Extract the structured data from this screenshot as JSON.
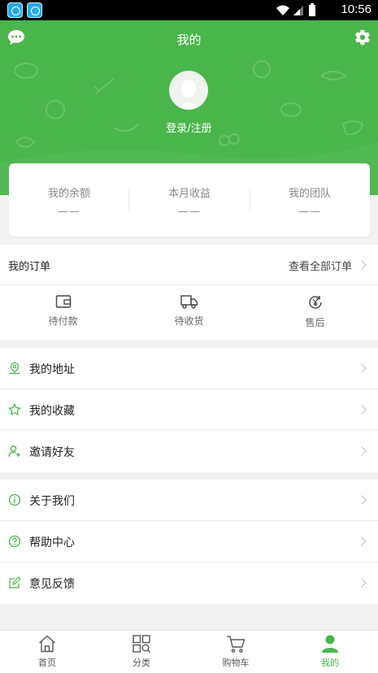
{
  "status_bar": {
    "time": "10:56"
  },
  "header": {
    "title": "我的",
    "login_text": "登录/注册"
  },
  "stats": [
    {
      "label": "我的余额",
      "value": "——"
    },
    {
      "label": "本月收益",
      "value": "——"
    },
    {
      "label": "我的团队",
      "value": "——"
    }
  ],
  "orders": {
    "title": "我的订单",
    "view_all": "查看全部订单",
    "items": [
      {
        "label": "待付款",
        "icon": "wallet-icon"
      },
      {
        "label": "待收货",
        "icon": "truck-icon"
      },
      {
        "label": "售后",
        "icon": "yen-refund-icon"
      }
    ]
  },
  "menu_group_1": [
    {
      "label": "我的地址",
      "icon": "location-icon"
    },
    {
      "label": "我的收藏",
      "icon": "star-icon"
    },
    {
      "label": "邀请好友",
      "icon": "add-user-icon"
    }
  ],
  "menu_group_2": [
    {
      "label": "关于我们",
      "icon": "info-icon"
    },
    {
      "label": "帮助中心",
      "icon": "help-icon"
    },
    {
      "label": "意见反馈",
      "icon": "feedback-icon"
    }
  ],
  "tabbar": [
    {
      "label": "首页",
      "icon": "home-icon"
    },
    {
      "label": "分类",
      "icon": "category-icon"
    },
    {
      "label": "购物车",
      "icon": "cart-icon"
    },
    {
      "label": "我的",
      "icon": "user-icon",
      "active": true
    }
  ],
  "colors": {
    "brand_green": "#4ab54b",
    "background": "#f2f2f2"
  }
}
